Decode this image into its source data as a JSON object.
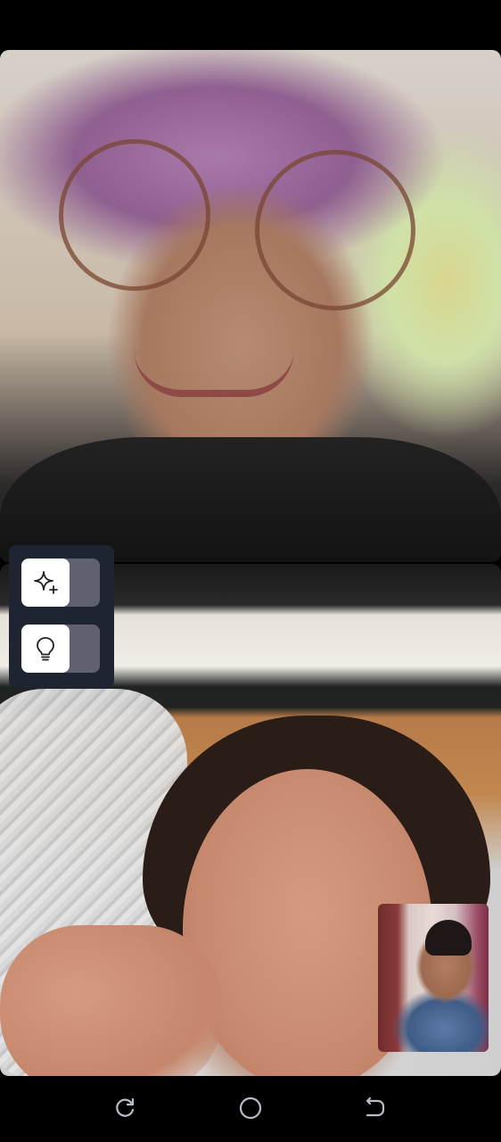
{
  "call": {
    "remote_top": {
      "participant": "remote-participant-1"
    },
    "remote_bottom": {
      "participant": "remote-participant-2"
    },
    "self_view": {
      "participant": "self"
    }
  },
  "effects_panel": {
    "toggles": [
      {
        "icon": "sparkle-icon",
        "state": "off"
      },
      {
        "icon": "lightbulb-icon",
        "state": "off"
      }
    ]
  },
  "nav_bar": {
    "buttons": [
      {
        "icon": "recents-icon"
      },
      {
        "icon": "home-icon"
      },
      {
        "icon": "back-icon"
      }
    ]
  },
  "colors": {
    "panel_bg": "#1f2433",
    "toggle_track": "#5f6171",
    "toggle_knob": "#ffffff",
    "nav_icon": "#b8bcc6"
  }
}
